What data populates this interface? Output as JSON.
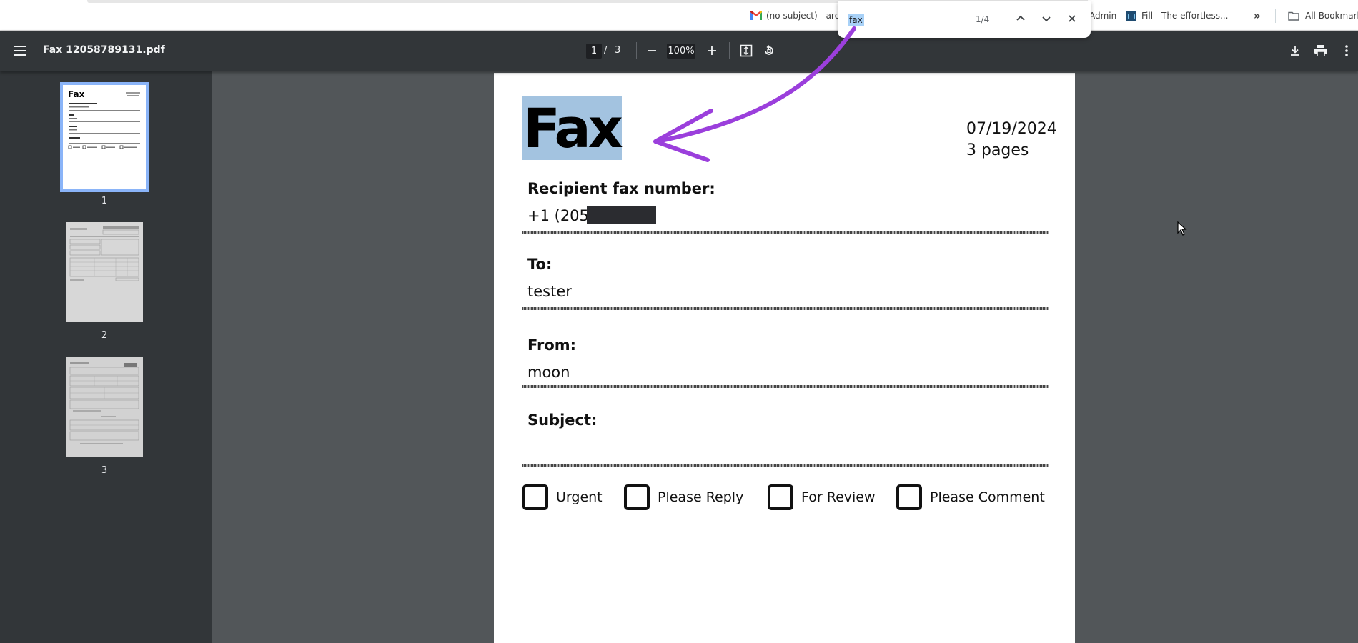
{
  "bookmarks": {
    "gmail_label": "(no subject) - archi",
    "admin_label": "Admin",
    "fill_label": "Fill - The effortless...",
    "overflow_label": "»",
    "all_bookmarks_label": "All Bookmarks"
  },
  "find_bar": {
    "query": "fax",
    "count": "1/4"
  },
  "toolbar": {
    "file_name": "Fax 12058789131.pdf",
    "current_page": "1",
    "page_separator": "/",
    "total_pages": "3",
    "zoom": "100%"
  },
  "sidebar": {
    "thumbnails": [
      {
        "number": "1",
        "active": true
      },
      {
        "number": "2",
        "active": false
      },
      {
        "number": "3",
        "active": false
      }
    ]
  },
  "document": {
    "heading": "Fax",
    "date": "07/19/2024",
    "pages": "3 pages",
    "recipient_label": "Recipient fax number:",
    "recipient_value": "+1 (205)",
    "to_label": "To:",
    "to_value": "tester",
    "from_label": "From:",
    "from_value": "moon",
    "subject_label": "Subject:",
    "subject_value": "",
    "checkboxes": [
      "Urgent",
      "Please Reply",
      "For Review",
      "Please Comment"
    ]
  },
  "colors": {
    "annotation_arrow": "#9b3fdc",
    "toolbar_bg": "#323639",
    "viewer_bg": "#525659",
    "active_thumb_outline": "#8ab4f8",
    "text_highlight": "#a3c3e0"
  }
}
